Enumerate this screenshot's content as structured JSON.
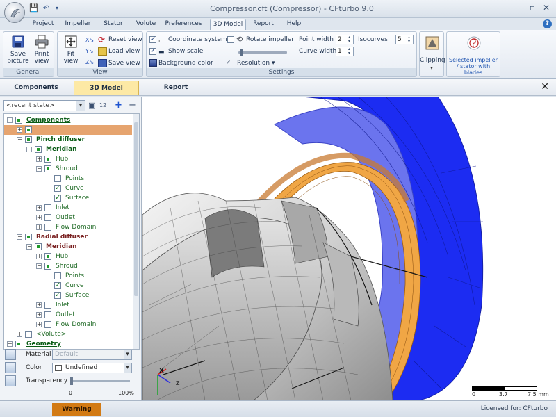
{
  "window": {
    "title": "Compressor.cft (Compressor) - CFturbo 9.0",
    "minimize": "–",
    "restore": "▫",
    "close": "✕"
  },
  "quick_access": {
    "save": "💾",
    "undo": "↶",
    "menu": "▾"
  },
  "menu": {
    "tabs": [
      {
        "label": "Project"
      },
      {
        "label": "Impeller"
      },
      {
        "label": "Stator"
      },
      {
        "label": "Volute"
      },
      {
        "label": "Preferences"
      },
      {
        "label": "3D Model"
      },
      {
        "label": "Report"
      },
      {
        "label": "Help"
      }
    ],
    "active": "3D Model",
    "help": "?"
  },
  "ribbon": {
    "general": {
      "label": "General",
      "save_picture": "Save picture",
      "print_view": "Print view"
    },
    "view": {
      "label": "View",
      "fit_view": "Fit view",
      "reset_view": "Reset view",
      "load_view": "Load view",
      "save_view": "Save view"
    },
    "settings": {
      "label": "Settings",
      "coordinate_system": "Coordinate system",
      "show_scale": "Show scale",
      "background_color": "Background color",
      "rotate_impeller": "Rotate impeller",
      "resolution": "Resolution",
      "point_width_label": "Point width",
      "point_width": "2",
      "curve_width_label": "Curve width",
      "curve_width": "1",
      "isocurves_label": "Isocurves",
      "isocurves": "5"
    },
    "clipping": {
      "label": "Clipping"
    },
    "selected": {
      "label": "Selected impeller / stator with blades"
    }
  },
  "view_tabs": [
    {
      "label": "Components"
    },
    {
      "label": "3D Model"
    },
    {
      "label": "Report"
    }
  ],
  "left_panel": {
    "state_placeholder": "<recent state>",
    "tree": [
      {
        "label": "Components",
        "style": "bold ul",
        "indent": 0,
        "exp": "−",
        "cb": "full"
      },
      {
        "label": "",
        "style": "sel",
        "indent": 1,
        "exp": "+",
        "cb": "full"
      },
      {
        "label": "Pinch diffuser",
        "style": "bold",
        "indent": 1,
        "exp": "−",
        "cb": "full"
      },
      {
        "label": "Meridian",
        "style": "bold",
        "indent": 2,
        "exp": "−",
        "cb": "full"
      },
      {
        "label": "Hub",
        "style": "green",
        "indent": 3,
        "exp": "+",
        "cb": "full"
      },
      {
        "label": "Shroud",
        "style": "green",
        "indent": 3,
        "exp": "−",
        "cb": "full"
      },
      {
        "label": "Points",
        "style": "green",
        "indent": 4,
        "exp": "",
        "cb": "empty"
      },
      {
        "label": "Curve",
        "style": "green",
        "indent": 4,
        "exp": "",
        "cb": "check"
      },
      {
        "label": "Surface",
        "style": "green",
        "indent": 4,
        "exp": "",
        "cb": "check"
      },
      {
        "label": "Inlet",
        "style": "green",
        "indent": 3,
        "exp": "+",
        "cb": "empty"
      },
      {
        "label": "Outlet",
        "style": "green",
        "indent": 3,
        "exp": "+",
        "cb": "empty"
      },
      {
        "label": "Flow Domain",
        "style": "green",
        "indent": 3,
        "exp": "+",
        "cb": "empty"
      },
      {
        "label": "Radial diffuser",
        "style": "red",
        "indent": 1,
        "exp": "−",
        "cb": "full"
      },
      {
        "label": "Meridian",
        "style": "red",
        "indent": 2,
        "exp": "−",
        "cb": "full"
      },
      {
        "label": "Hub",
        "style": "green",
        "indent": 3,
        "exp": "+",
        "cb": "full"
      },
      {
        "label": "Shroud",
        "style": "green",
        "indent": 3,
        "exp": "−",
        "cb": "full"
      },
      {
        "label": "Points",
        "style": "green",
        "indent": 4,
        "exp": "",
        "cb": "empty"
      },
      {
        "label": "Curve",
        "style": "green",
        "indent": 4,
        "exp": "",
        "cb": "check"
      },
      {
        "label": "Surface",
        "style": "green",
        "indent": 4,
        "exp": "",
        "cb": "check"
      },
      {
        "label": "Inlet",
        "style": "green",
        "indent": 3,
        "exp": "+",
        "cb": "empty"
      },
      {
        "label": "Outlet",
        "style": "green",
        "indent": 3,
        "exp": "+",
        "cb": "empty"
      },
      {
        "label": "Flow Domain",
        "style": "green",
        "indent": 3,
        "exp": "+",
        "cb": "empty"
      },
      {
        "label": "<Volute>",
        "style": "green",
        "indent": 1,
        "exp": "+",
        "cb": "empty"
      },
      {
        "label": "Geometry",
        "style": "bold ul",
        "indent": 0,
        "exp": "+",
        "cb": "full"
      }
    ],
    "properties": {
      "material_label": "Material",
      "material_value": "Default",
      "color_label": "Color",
      "color_value": "Undefined",
      "transparency_label": "Transparency",
      "transparency_min": "0",
      "transparency_max": "100%",
      "transparency_value": 0
    }
  },
  "viewport": {
    "axis_x": "X",
    "axis_z": "Z",
    "scale": [
      "0",
      "3.7",
      "7.5 mm"
    ]
  },
  "status": {
    "warning": "Warning",
    "license": "Licensed for: CFturbo"
  },
  "colors": {
    "accent": "#fde9a5",
    "selection": "#e6a46f",
    "warning": "#d27a14",
    "diffuser_blue": "#1f2ff0",
    "diffuser_orange": "#f0a040"
  }
}
